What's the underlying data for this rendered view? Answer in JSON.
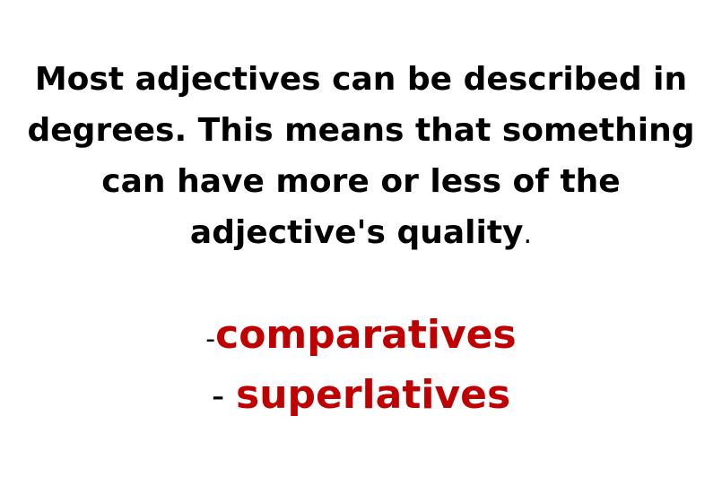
{
  "slide": {
    "body_text": "Most adjectives can be described in degrees. This means that something can have more or less of the adjective's quality",
    "body_end": ".",
    "items": [
      {
        "prefix": "-",
        "term": "comparatives"
      },
      {
        "prefix": "- ",
        "term": "superlatives"
      }
    ]
  },
  "colors": {
    "text": "#000000",
    "highlight": "#c00000",
    "background": "#ffffff"
  }
}
